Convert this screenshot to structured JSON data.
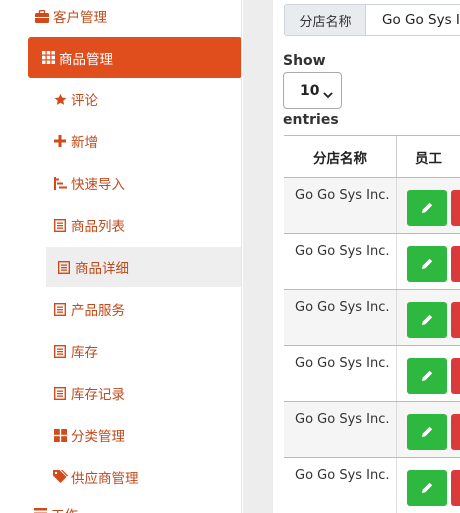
{
  "sidebar": {
    "top_item": "客户管理",
    "active_item": "商品管理",
    "sub_items": [
      {
        "label": "评论",
        "icon": "star-icon"
      },
      {
        "label": "新增",
        "icon": "plus-icon"
      },
      {
        "label": "快速导入",
        "icon": "sitemap-icon"
      },
      {
        "label": "商品列表",
        "icon": "list-icon"
      },
      {
        "label": "商品详细",
        "icon": "list-icon"
      },
      {
        "label": "产品服务",
        "icon": "list-icon"
      },
      {
        "label": "库存",
        "icon": "list-icon"
      },
      {
        "label": "库存记录",
        "icon": "list-icon"
      },
      {
        "label": "分类管理",
        "icon": "grid-icon"
      },
      {
        "label": "供应商管理",
        "icon": "tags-icon"
      }
    ],
    "selected_index": 4,
    "cut_item": "工作"
  },
  "search": {
    "label": "分店名称",
    "value": "Go Go Sys Inc."
  },
  "entries": {
    "show_label": "Show",
    "selected": "10",
    "entries_label": "entries"
  },
  "table": {
    "headers": [
      "分店名称",
      "员工"
    ],
    "rows": [
      {
        "name": "Go Go Sys Inc."
      },
      {
        "name": "Go Go Sys Inc."
      },
      {
        "name": "Go Go Sys Inc."
      },
      {
        "name": "Go Go Sys Inc."
      },
      {
        "name": "Go Go Sys Inc."
      },
      {
        "name": "Go Go Sys Inc."
      }
    ]
  },
  "colors": {
    "accent": "#e14e1d",
    "nav_text": "#c04a1b",
    "edit_button": "#2eb83f",
    "delete_button": "#d93b3b"
  }
}
